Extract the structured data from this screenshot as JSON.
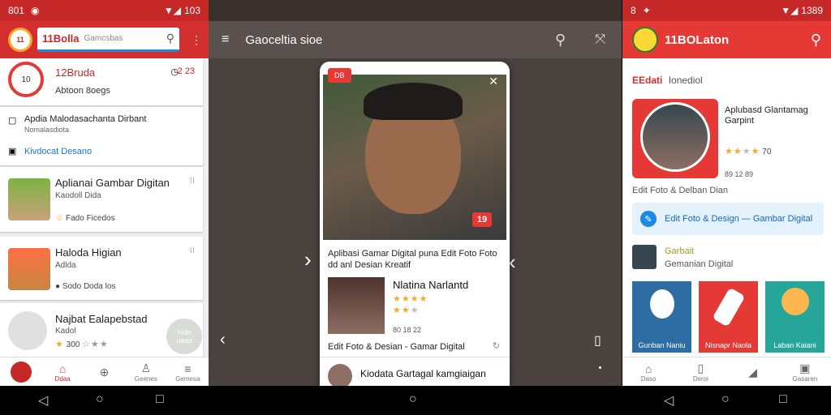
{
  "left": {
    "status": {
      "left": "801",
      "right": "103"
    },
    "appbar": {
      "title": "11Bolla",
      "search_placeholder": "Gamcsbas"
    },
    "profile": {
      "name": "12Bruda",
      "time": "2 23",
      "subtitle": "Abtoon 8oegs"
    },
    "info_rows": [
      {
        "title": "Apdia Malodasachanta Dirbant",
        "sub": "Nomalasdiota"
      },
      {
        "link": "Kivdocat Desano"
      }
    ],
    "items": [
      {
        "title": "Aplianai Gambar Digitan",
        "sub": "Kaodoll Dida",
        "meta": "Fado Ficedos"
      },
      {
        "title": "Haloda Higian",
        "sub": "Adlda",
        "meta": "Sodo Doda los"
      },
      {
        "title": "Najbat Ealapebstad",
        "sub": "Kadol",
        "meta": "300"
      }
    ],
    "fab_label": "Hdn\nuasu",
    "nav": [
      "Ddaa",
      "",
      "Geenes",
      "Gemesa"
    ],
    "colors": {
      "primary": "#d32f2f",
      "link": "#1976d2"
    }
  },
  "center": {
    "appbar_title": "Gaoceltia sioe",
    "dialog": {
      "badge": "DB",
      "photo_badge": "19",
      "title": "Aplibasi Gamar Digital puna Edit Foto Foto dd anl Desian Kreatif",
      "user_name": "Nlatina Narlantd",
      "user_meta": "80 18 22",
      "caption": "Edit Foto & Desian - Gamar Digital",
      "next_title": "Kiodata Gartagal kamgiaigan"
    }
  },
  "right": {
    "status": {
      "left": "8",
      "right": "1389"
    },
    "appbar_title": "11BOLaton",
    "section_title": "EEdati",
    "section_sub": "Ionediol",
    "feature": {
      "title": "Aplubasd Glantamag Garpint",
      "rating_value": "70",
      "meta": "89 12 89"
    },
    "feature_caption": "Edit Foto & Delban Dian",
    "banner": "Edit Foto & Design — Gambar Digital",
    "mini": {
      "title": "Garbait",
      "sub": "Gemanian Digital"
    },
    "tiles": [
      {
        "label": "Gunban Naniu",
        "color": "#2e6da4"
      },
      {
        "label": "Nisnapr Naola",
        "color": "#e53935"
      },
      {
        "label": "Laban Kaiani",
        "color": "#26a69a"
      }
    ],
    "nav": [
      "Daso",
      "Deroi",
      "",
      "Gasaren"
    ]
  }
}
